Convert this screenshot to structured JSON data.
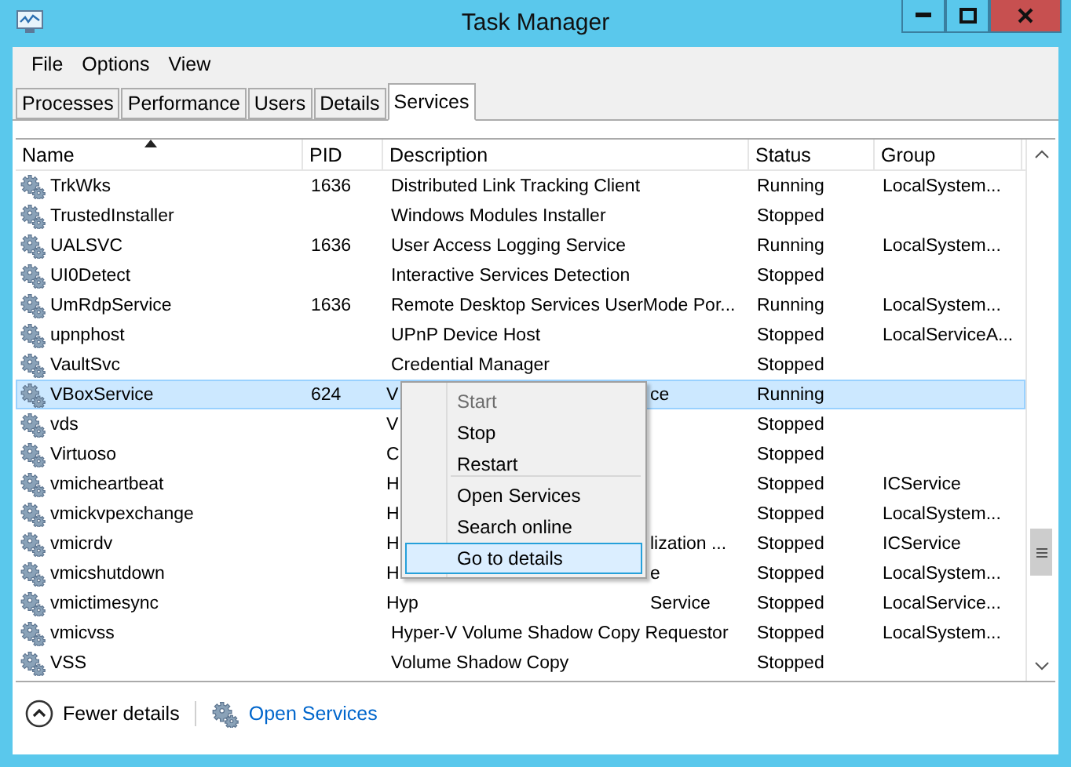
{
  "window": {
    "title": "Task Manager"
  },
  "menu_bar": [
    "File",
    "Options",
    "View"
  ],
  "tabs": [
    {
      "label": "Processes",
      "selected": false
    },
    {
      "label": "Performance",
      "selected": false
    },
    {
      "label": "Users",
      "selected": false
    },
    {
      "label": "Details",
      "selected": false
    },
    {
      "label": "Services",
      "selected": true
    }
  ],
  "table": {
    "columns": [
      {
        "label": "Name",
        "sorted": true
      },
      {
        "label": "PID",
        "sorted": false
      },
      {
        "label": "Description",
        "sorted": false
      },
      {
        "label": "Status",
        "sorted": false
      },
      {
        "label": "Group",
        "sorted": false
      }
    ],
    "rows": [
      {
        "name": "TrkWks",
        "pid": "1636",
        "description": "Distributed Link Tracking Client",
        "status": "Running",
        "group": "LocalSystem...",
        "selected": false
      },
      {
        "name": "TrustedInstaller",
        "description": "Windows Modules Installer",
        "status": "Stopped",
        "selected": false
      },
      {
        "name": "UALSVC",
        "pid": "1636",
        "description": "User Access Logging Service",
        "status": "Running",
        "group": "LocalSystem...",
        "selected": false
      },
      {
        "name": "UI0Detect",
        "description": "Interactive Services Detection",
        "status": "Stopped",
        "selected": false
      },
      {
        "name": "UmRdpService",
        "pid": "1636",
        "description": "Remote Desktop Services UserMode Por...",
        "status": "Running",
        "group": "LocalSystem...",
        "selected": false
      },
      {
        "name": "upnphost",
        "description": "UPnP Device Host",
        "status": "Stopped",
        "group": "LocalServiceA...",
        "selected": false
      },
      {
        "name": "VaultSvc",
        "description": "Credential Manager",
        "status": "Stopped",
        "selected": false
      },
      {
        "name": "VBoxService",
        "pid": "624",
        "description_start": "V",
        "description_end": "ce",
        "status": "Running",
        "selected": true
      },
      {
        "name": "vds",
        "description_start": "V",
        "status": "Stopped",
        "selected": false
      },
      {
        "name": "Virtuoso",
        "description_start": "C",
        "status": "Stopped",
        "selected": false
      },
      {
        "name": "vmicheartbeat",
        "description_start": "H",
        "status": "Stopped",
        "group": "ICService",
        "selected": false
      },
      {
        "name": "vmickvpexchange",
        "description_start": "H",
        "status": "Stopped",
        "group": "LocalSystem...",
        "selected": false
      },
      {
        "name": "vmicrdv",
        "description_start": "H",
        "description_end": "lization ...",
        "status": "Stopped",
        "group": "ICService",
        "selected": false
      },
      {
        "name": "vmicshutdown",
        "description_start": "H",
        "description_end": "e",
        "status": "Stopped",
        "group": "LocalSystem...",
        "selected": false
      },
      {
        "name": "vmictimesync",
        "description_start": "Hyp",
        "description_end": "Service",
        "status": "Stopped",
        "group": "LocalService...",
        "selected": false
      },
      {
        "name": "vmicvss",
        "description": "Hyper-V Volume Shadow Copy Requestor",
        "status": "Stopped",
        "group": "LocalSystem...",
        "selected": false
      },
      {
        "name": "VSS",
        "description": "Volume Shadow Copy",
        "status": "Stopped",
        "selected": false
      }
    ]
  },
  "context_menu": [
    {
      "label": "Start",
      "disabled": true,
      "highlighted": false,
      "separator_before": false
    },
    {
      "label": "Stop",
      "disabled": false,
      "highlighted": false,
      "separator_before": false
    },
    {
      "label": "Restart",
      "disabled": false,
      "highlighted": false,
      "separator_before": false
    },
    {
      "label": "Open Services",
      "disabled": false,
      "highlighted": false,
      "separator_before": true
    },
    {
      "label": "Search online",
      "disabled": false,
      "highlighted": false,
      "separator_before": false
    },
    {
      "label": "Go to details",
      "disabled": false,
      "highlighted": true,
      "separator_before": false
    }
  ],
  "footer": {
    "fewer_details": "Fewer details",
    "open_services": "Open Services"
  }
}
